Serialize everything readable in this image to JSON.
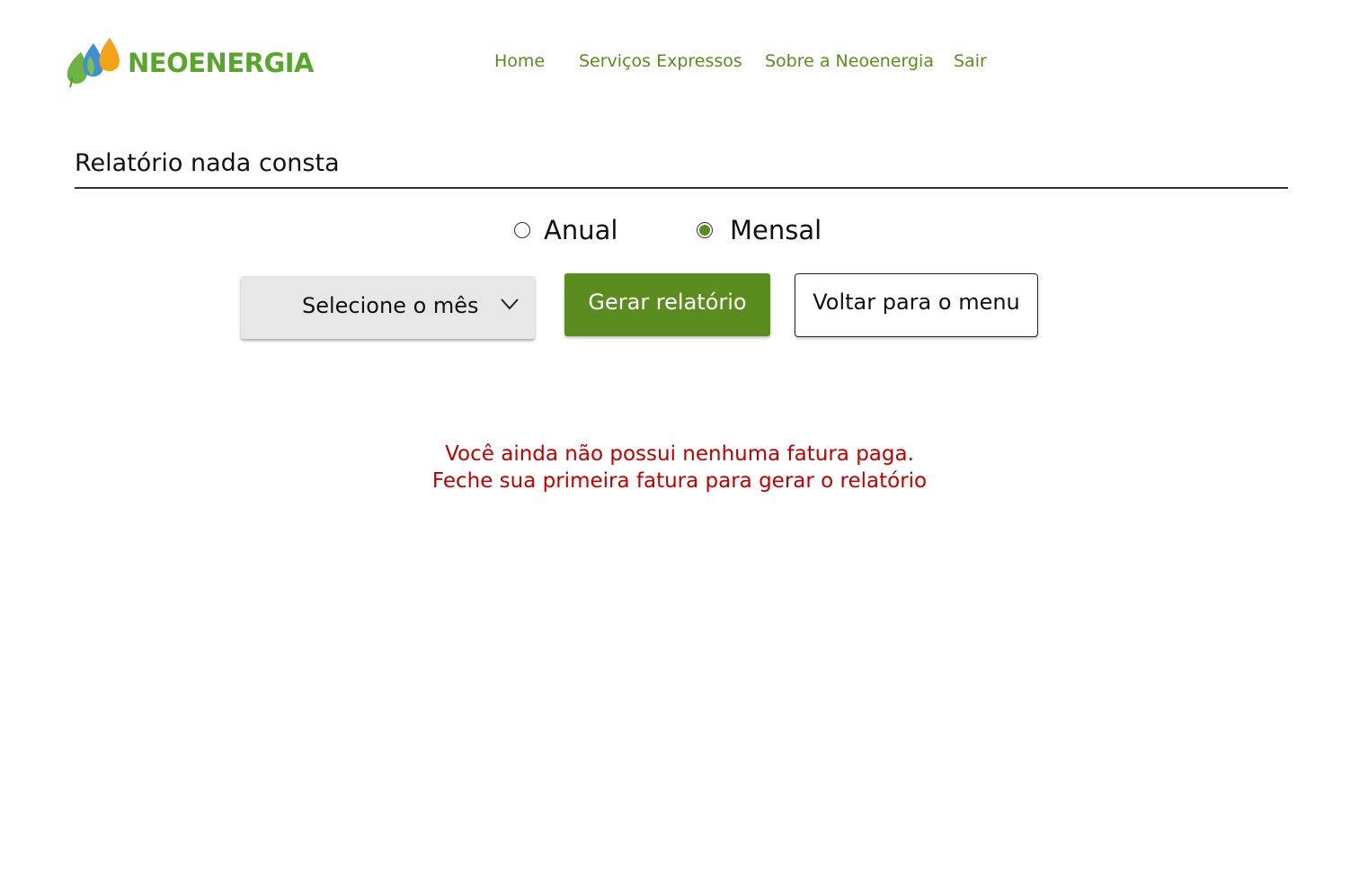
{
  "brand": {
    "name": "NEOENERGIA",
    "color": "#58a72b"
  },
  "nav": {
    "items": [
      {
        "label": "Home"
      },
      {
        "label": "Serviços Expressos"
      },
      {
        "label": "Sobre a Neoenergia"
      },
      {
        "label": "Sair"
      }
    ],
    "color": "#5b8c1f"
  },
  "page": {
    "title": "Relatório nada consta"
  },
  "report_type": {
    "options": [
      {
        "label": "Anual",
        "selected": false
      },
      {
        "label": "Mensal",
        "selected": true
      }
    ],
    "selected_color": "#5b8c1f"
  },
  "month_select": {
    "value": "Selecione o mês",
    "icon": "chevron-down-icon"
  },
  "buttons": {
    "generate_label": "Gerar relatório",
    "generate_color": "#5b8c1f",
    "back_label": "Voltar para o menu"
  },
  "message": {
    "line1": "Você ainda não possui nenhuma fatura paga.",
    "line2": "Feche sua primeira fatura para gerar o relatório",
    "color": "#c00000"
  }
}
